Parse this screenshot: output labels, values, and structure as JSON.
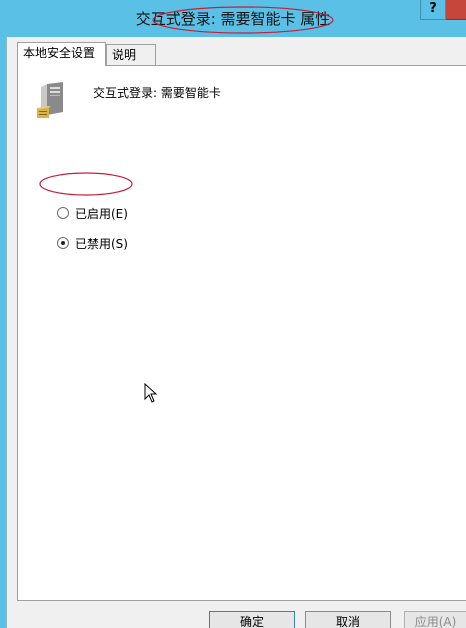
{
  "window": {
    "title": "交互式登录: 需要智能卡 属性",
    "help_label": "?"
  },
  "tabs": [
    {
      "label": "本地安全设置",
      "active": true
    },
    {
      "label": "说明",
      "active": false
    }
  ],
  "policy": {
    "name": "交互式登录: 需要智能卡",
    "icon": "server-icon"
  },
  "options": [
    {
      "label": "已启用(E)",
      "checked": false
    },
    {
      "label": "已禁用(S)",
      "checked": true
    }
  ],
  "buttons": {
    "ok": "确定",
    "cancel": "取消",
    "apply": "应用(A)"
  },
  "colors": {
    "titlebar": "#5bc0e6",
    "close": "#c7463b",
    "annotation": "#c0203a"
  }
}
